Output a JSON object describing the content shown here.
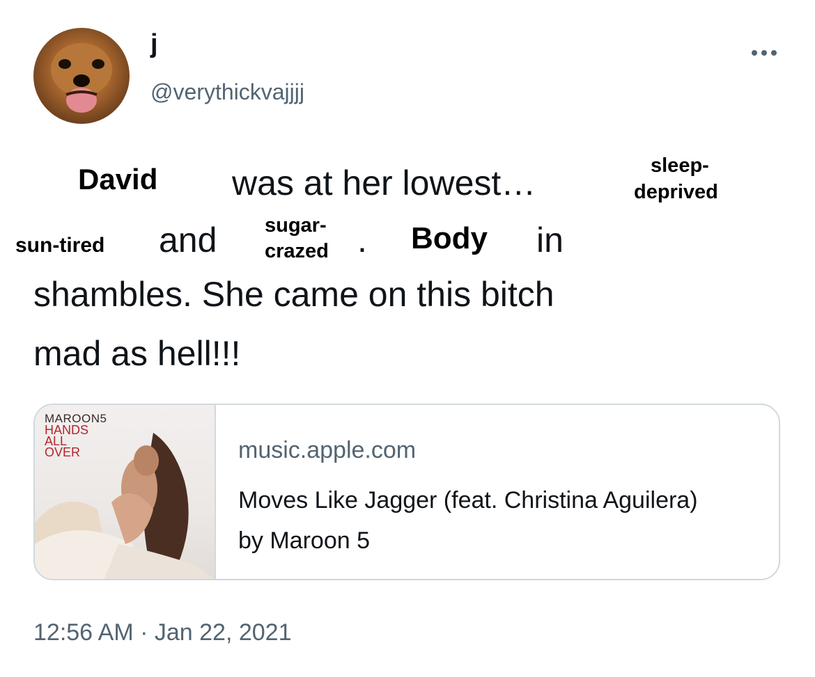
{
  "tweet": {
    "display_name": "j",
    "handle": "@verythickvajjjj",
    "more_icon": "more-horizontal-icon",
    "text_words": {
      "was_at_her_lowest": "was at her lowest…",
      "and": "and",
      "period": ".",
      "in": "in",
      "line3": "shambles. She came on this bitch",
      "line4": "mad as hell!!!"
    },
    "edits": {
      "name": "David",
      "sleep": "sleep-",
      "deprived": "deprived",
      "sun_tired": "sun-tired",
      "sugar": "sugar-",
      "crazed": "crazed",
      "body": "Body"
    },
    "card": {
      "album_artist": "MAROON5",
      "album_title": "HANDS ALL OVER",
      "domain": "music.apple.com",
      "title": "Moves Like Jagger (feat. Christina Aguilera) by Maroon 5"
    },
    "timestamp": "12:56 AM · Jan 22, 2021"
  }
}
